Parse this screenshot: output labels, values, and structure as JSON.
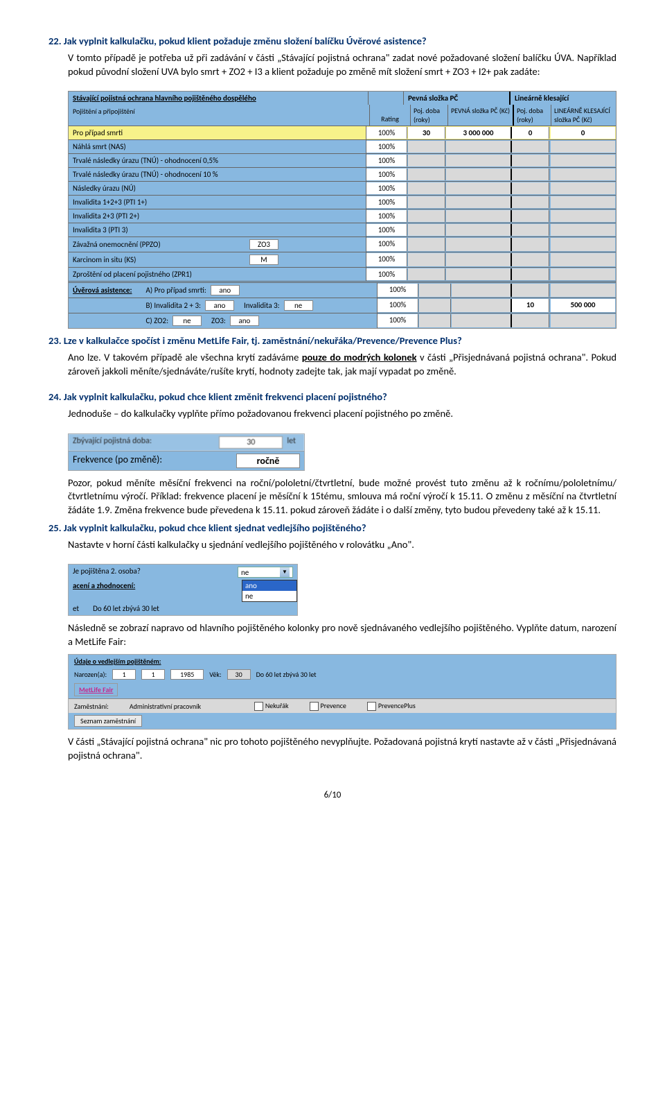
{
  "q22": {
    "title": "22.  Jak vyplnit kalkulačku, pokud klient požaduje změnu složení balíčku Úvěrové asistence?",
    "p1": "V tomto případě je potřeba už při zadávání v části „Stávající pojistná ochrana\" zadat nové požadované složení balíčku ÚVA. Například pokud původní složení UVA bylo smrt + ZO2 + I3 a klient požaduje po změně mít složení smrt + ZO3 + I2+ pak zadáte:"
  },
  "tbl": {
    "header_main": "Stávající pojistná ochrana hlavního pojištěného dospělého",
    "header_pev": "Pevná složka PČ",
    "header_lin": "Lineárně klesající",
    "sub_main": "Pojištění a  připojištění",
    "sub_rat": "Rating",
    "sub_p1": "Poj. doba (roky)",
    "sub_p2": "PEVNÁ složka PČ (Kč)",
    "sub_l1": "Poj. doba (roky)",
    "sub_l2": "LINEÁRNĚ KLESAJÍCÍ složka PČ (Kč)",
    "rows": [
      {
        "name": "Pro případ smrti",
        "rat": "100%",
        "p1": "30",
        "p2": "3 000 000",
        "l1": "0",
        "l2": "0",
        "hi": true
      },
      {
        "name": "Náhlá smrt (NAS)",
        "rat": "100%"
      },
      {
        "name": "Trvalé následky úrazu (TNÚ) - ohodnocení 0,5%",
        "rat": "100%"
      },
      {
        "name": "Trvalé následky úrazu (TNÚ) - ohodnocení 10 %",
        "rat": "100%"
      },
      {
        "name": "Následky úrazu (NÚ)",
        "rat": "100%"
      },
      {
        "name": "Invalidita 1+2+3 (PTI 1+)",
        "rat": "100%"
      },
      {
        "name": "Invalidita 2+3 (PTI 2+)",
        "rat": "100%"
      },
      {
        "name": "Invalidita 3 (PTI 3)",
        "rat": "100%"
      },
      {
        "name": "Závažná onemocnění (PPZO)",
        "rat": "100%",
        "inset": "ZO3"
      },
      {
        "name": "Karcinom in situ (KS)",
        "rat": "100%",
        "inset": "M"
      },
      {
        "name": "Zproštění od placení pojistného (ZPR1)",
        "rat": "100%"
      }
    ],
    "ua_label": "Úvěrová asistence:",
    "ua_a": "A) Pro případ smrti:",
    "ua_a_v": "ano",
    "ua_b": "B)  Invalidita 2 + 3:",
    "ua_b_v": "ano",
    "ua_b2": "Invalidita 3:",
    "ua_b2_v": "ne",
    "ua_b_l1": "10",
    "ua_b_l2": "500 000",
    "ua_c": "C)  ZO2:",
    "ua_c_v": "ne",
    "ua_c2": "ZO3:",
    "ua_c2_v": "ano"
  },
  "q23": {
    "title": "23.  Lze v kalkulačce spočíst i změnu MetLife Fair, tj. zaměstnání/nekuřáka/Prevence/Prevence Plus?",
    "p1a": "Ano lze. V takovém případě ale všechna krytí zadáváme ",
    "p1b": "pouze do modrých kolonek",
    "p1c": " v části „Přisjednávaná pojistná ochrana\". Pokud zároveň jakkoli měníte/sjednáváte/rušíte krytí, hodnoty zadejte tak, jak mají vypadat po změně."
  },
  "q24": {
    "title": "24.  Jak vyplnit kalkulačku, pokud chce klient změnit frekvenci placení pojistného?",
    "p1": "Jednoduše – do kalkulačky vyplňte přímo požadovanou frekvenci placení pojistného po změně.",
    "p2": "Pozor, pokud měníte měsíční frekvenci na roční/pololetní/čtvrtletní, bude možné provést tuto změnu až k ročnímu/pololetnímu/čtvrtletnímu výročí. Příklad: frekvence placení je měsíční k 15tému, smlouva má roční výročí k 15.11. O změnu z měsíční na čtvrtletní žádáte 1.9. Změna frekvence bude převedena k 15.11. pokud zároveň žádáte i o další změny, tyto budou převedeny také až k 15.11."
  },
  "freq": {
    "row0_lab": "Zbývající pojistná doba:",
    "row0_val": "30",
    "row0_unit": "let",
    "row1_lab": "Frekvence (po změně):",
    "row1_val": "ročně"
  },
  "q25": {
    "title": "25.  Jak vyplnit kalkulačku, pokud chce klient sjednat vedlejšího pojištěného?",
    "p1": "Nastavte v horní části kalkulačky u sjednání vedlejšího pojištěného v rolovátku „Ano\".",
    "p2": "Následně se zobrazí napravo od hlavního pojištěného kolonky pro nově sjednávaného vedlejšího pojištěného. Vyplňte datum, narození a MetLife Fair:",
    "p3": "V části „Stávající pojistná ochrana\" nic pro tohoto pojištěného nevyplňujte. Požadovaná pojistná krytí nastavte až v části „Přisjednávaná pojistná ochrana\"."
  },
  "dd": {
    "lab": "Je pojištěna 2. osoba?",
    "sel": "ne",
    "opt1": "ano",
    "opt2": "ne",
    "under": "acení a zhodnocení:",
    "bot_l": "et",
    "bot_r": "Do 60 let zbývá 30 let"
  },
  "det": {
    "hdr": "Údaje o vedlejším pojištěném:",
    "nar": "Narozen(a):",
    "d": "1",
    "m": "1",
    "y": "1985",
    "vek_l": "Věk:",
    "vek": "30",
    "zby": "Do 60 let zbývá 30 let",
    "mf": "MetLife Fair",
    "zam_l": "Zaměstnání:",
    "zam_v": "Administrativní pracovník",
    "chk1": "Nekuřák",
    "chk2": "Prevence",
    "chk3": "PrevencePlus",
    "btn": "Seznam zaměstnání"
  },
  "page": "6/10"
}
